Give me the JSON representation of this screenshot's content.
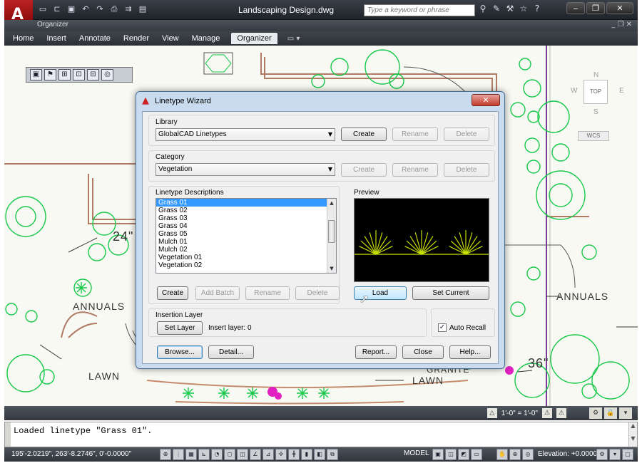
{
  "window": {
    "title": "Landscaping Design.dwg",
    "search_placeholder": "Type a keyword or phrase",
    "doc_tab": "Organizer",
    "app_letter": "A"
  },
  "menu": {
    "items": [
      "Home",
      "Insert",
      "Annotate",
      "Render",
      "View",
      "Manage",
      "Organizer"
    ],
    "active": "Organizer"
  },
  "drawing": {
    "labels": {
      "annuals_left": "ANNUALS",
      "annuals_right": "ANNUALS",
      "lawn_left": "LAWN",
      "lawn_right": "LAWN",
      "dim_24": "24\"",
      "dim_36": "36\"",
      "granite": "GRANITE"
    },
    "viewcube": {
      "top": "TOP",
      "n": "N",
      "s": "S",
      "e": "E",
      "w": "W",
      "wcs": "WCS"
    },
    "colors": {
      "plant": "#17c84a",
      "magenta": "#e020c0",
      "wall": "#b07a63",
      "purple": "#7a3a9a"
    }
  },
  "dialog": {
    "title": "Linetype Wizard",
    "library": {
      "label": "Library",
      "value": "GlobalCAD Linetypes",
      "buttons": {
        "create": "Create",
        "rename": "Rename",
        "delete": "Delete"
      }
    },
    "category": {
      "label": "Category",
      "value": "Vegetation",
      "buttons": {
        "create": "Create",
        "rename": "Rename",
        "delete": "Delete"
      }
    },
    "descriptions": {
      "label": "Linetype Descriptions",
      "items": [
        "Grass 01",
        "Grass 02",
        "Grass 03",
        "Grass 04",
        "Grass 05",
        "Mulch 01",
        "Mulch 02",
        "Vegetation 01",
        "Vegetation 02"
      ],
      "selected_index": 0,
      "buttons": {
        "create": "Create",
        "add_batch": "Add Batch",
        "rename": "Rename",
        "delete": "Delete"
      }
    },
    "preview": {
      "label": "Preview",
      "line_color": "#c8e000",
      "buttons": {
        "load": "Load",
        "set_current": "Set Current"
      }
    },
    "insertion": {
      "label": "Insertion Layer",
      "set_layer": "Set Layer",
      "insert_layer_text": "Insert layer: 0",
      "auto_recall_label": "Auto Recall",
      "auto_recall_checked": true
    },
    "footer": {
      "browse": "Browse...",
      "detail": "Detail...",
      "report": "Report...",
      "close": "Close",
      "help": "Help..."
    }
  },
  "annotation_scale": "1'-0\" = 1'-0\"",
  "command_line": "Loaded linetype \"Grass 01\".",
  "status": {
    "coords": "195'-2.0219\", 263'-8.2746\", 0'-0.0000\"",
    "model": "MODEL",
    "elevation": "Elevation:  +0.0000\""
  }
}
